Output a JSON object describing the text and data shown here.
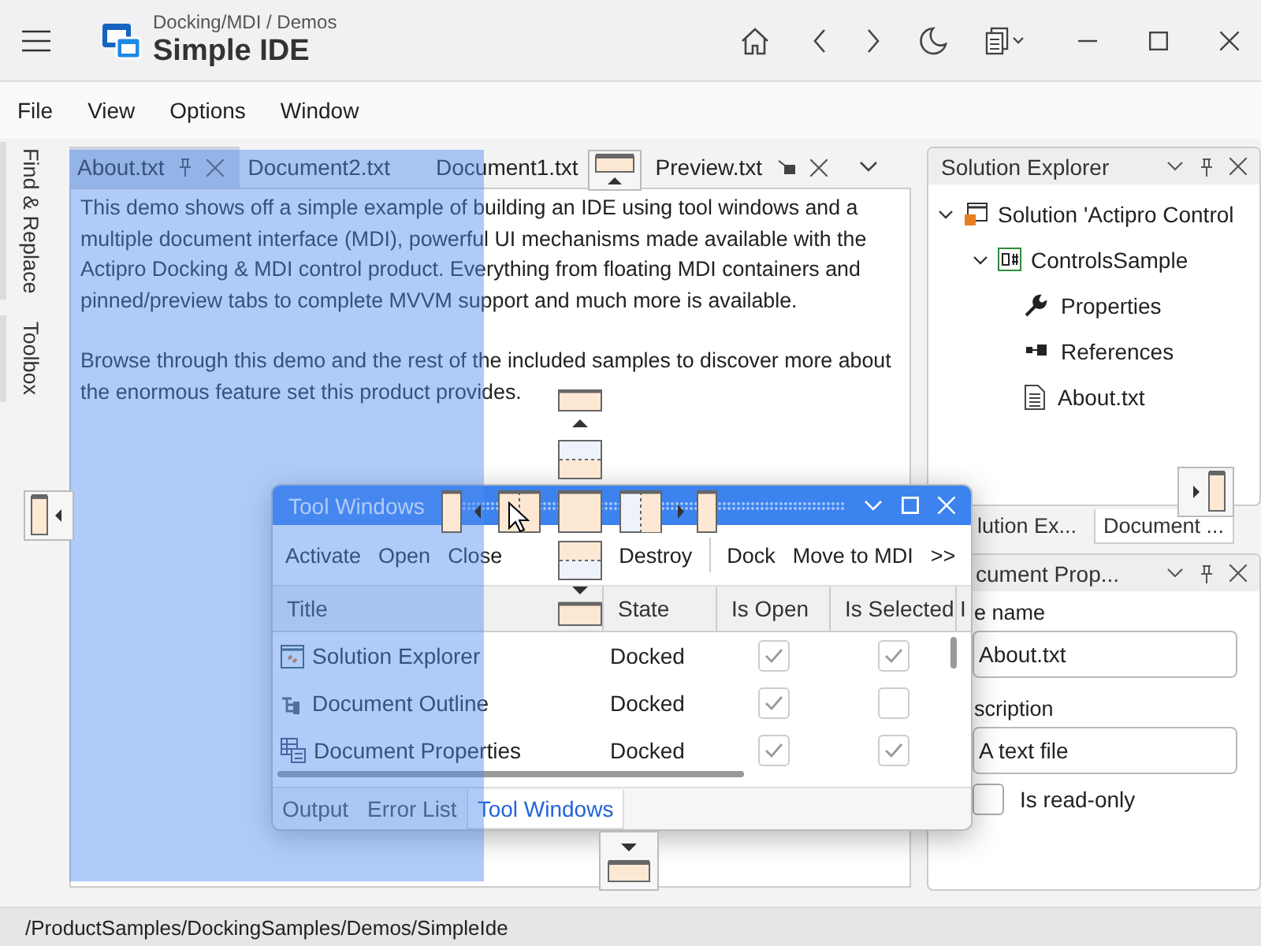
{
  "app": {
    "breadcrumb": "Docking/MDI / Demos",
    "title": "Simple IDE"
  },
  "menu": [
    "File",
    "View",
    "Options",
    "Window"
  ],
  "side_tabs": [
    "Find & Replace",
    "Toolbox"
  ],
  "documents": {
    "tabs": [
      {
        "label": "About.txt",
        "selected": true,
        "kind": "pinned"
      },
      {
        "label": "Document2.txt",
        "selected": false,
        "kind": "normal"
      },
      {
        "label": "Document1.txt",
        "selected": false,
        "kind": "normal"
      },
      {
        "label": "Preview.txt",
        "selected": false,
        "kind": "preview"
      }
    ],
    "paragraphs": [
      "This demo shows off a simple example of building an IDE using tool windows and a multiple document interface (MDI), powerful UI mechanisms made available with the Actipro Docking & MDI control product. Everything from floating MDI containers and pinned/preview tabs to complete MVVM support and much more is available.",
      "Browse through this demo and the rest of the included samples to discover more about the enormous feature set this product provides."
    ]
  },
  "solution_explorer": {
    "title": "Solution Explorer",
    "tree": [
      {
        "label": "Solution 'Actipro Control",
        "kind": "solution",
        "expanded": true,
        "children": [
          {
            "label": "ControlsSample",
            "kind": "project",
            "expanded": true,
            "children": [
              {
                "label": "Properties",
                "kind": "properties"
              },
              {
                "label": "References",
                "kind": "references"
              },
              {
                "label": "About.txt",
                "kind": "file"
              }
            ]
          }
        ]
      }
    ],
    "tabs": [
      {
        "label": "lution Ex...",
        "selected": false
      },
      {
        "label": "Document ...",
        "selected": true
      }
    ]
  },
  "document_properties": {
    "title": "cument Prop...",
    "fields": [
      {
        "label": "e name",
        "value": "About.txt"
      },
      {
        "label": "scription",
        "value": "A text file"
      }
    ],
    "read_only": {
      "label": "Is read-only",
      "checked": false
    }
  },
  "tool_window": {
    "title": "Tool Windows",
    "action_groups": [
      [
        "Activate",
        "Open",
        "Close",
        "Destroy"
      ],
      [
        "Dock",
        "Move to MDI",
        ">>"
      ]
    ],
    "columns": [
      "Title",
      "State",
      "Is Open",
      "Is Selected",
      "I"
    ],
    "rows": [
      {
        "title": "Solution Explorer",
        "kind": "explorer",
        "state": "Docked",
        "is_open": true,
        "is_selected": true
      },
      {
        "title": "Document Outline",
        "kind": "outline",
        "state": "Docked",
        "is_open": true,
        "is_selected": false
      },
      {
        "title": "Document Properties",
        "kind": "properties",
        "state": "Docked",
        "is_open": true,
        "is_selected": true
      }
    ],
    "tabs": [
      {
        "label": "Output",
        "selected": false
      },
      {
        "label": "Error List",
        "selected": false
      },
      {
        "label": "Tool Windows",
        "selected": true
      }
    ]
  },
  "status_bar": {
    "path": "/ProductSamples/DockingSamples/Demos/SimpleIde"
  }
}
